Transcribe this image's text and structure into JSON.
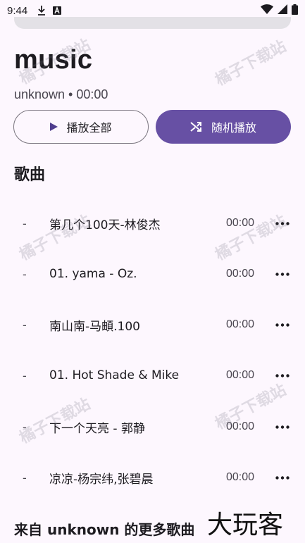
{
  "status_bar": {
    "time": "9:44",
    "icons": [
      "download-icon",
      "text-a-icon",
      "wifi-icon",
      "battery-icon"
    ]
  },
  "album": {
    "title": "music",
    "meta": "unknown • 00:00"
  },
  "buttons": {
    "play_all": "播放全部",
    "shuffle": "随机播放"
  },
  "songs_section": {
    "title": "歌曲",
    "items": [
      {
        "num": "-",
        "title": "第几个100天-林俊杰",
        "duration": "00:00"
      },
      {
        "num": "-",
        "title": "01. yama - Oz.",
        "duration": "00:00"
      },
      {
        "num": "-",
        "title": "南山南-马頔.100",
        "duration": "00:00"
      },
      {
        "num": "-",
        "title": "01. Hot Shade & Mike",
        "duration": "00:00"
      },
      {
        "num": "-",
        "title": "下一个天亮 - 郭静",
        "duration": "00:00"
      },
      {
        "num": "-",
        "title": "凉凉-杨宗纬,张碧晨",
        "duration": "00:00"
      }
    ]
  },
  "more_section": {
    "title": "来自 unknown 的更多歌曲"
  },
  "watermark_text": "橘子下载站",
  "logo_text": "大玩客",
  "colors": {
    "accent": "#6750a4",
    "background": "#fdf7fe",
    "text": "#1d1b20",
    "secondary_text": "#49454f"
  }
}
